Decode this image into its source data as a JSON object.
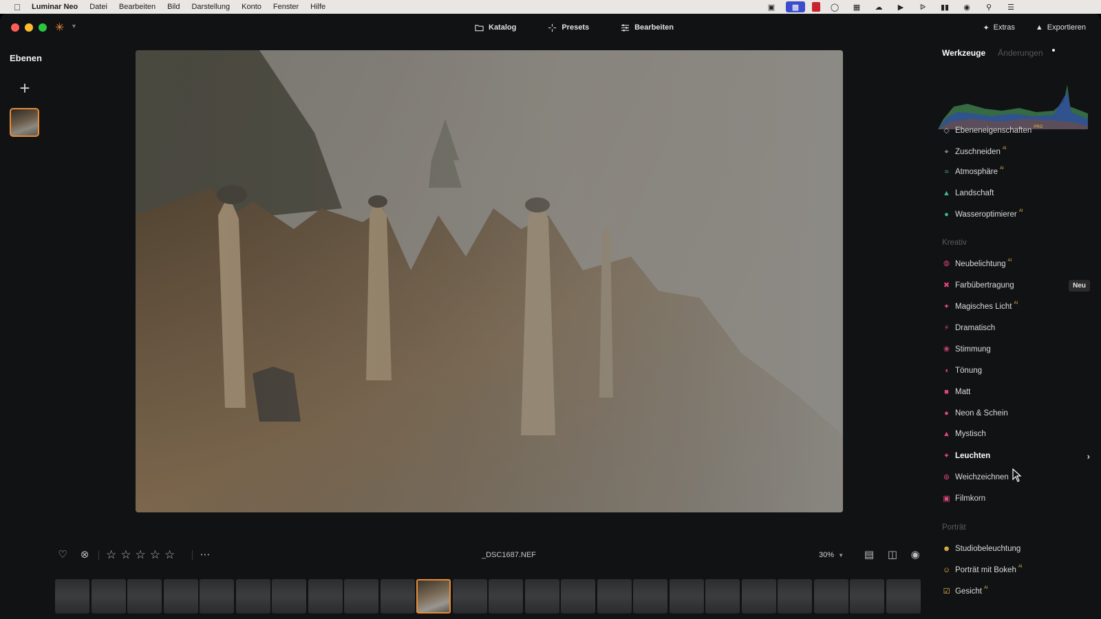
{
  "menubar": {
    "app_name": "Luminar Neo",
    "items": [
      "Datei",
      "Bearbeiten",
      "Bild",
      "Darstellung",
      "Konto",
      "Fenster",
      "Hilfe"
    ],
    "status_icons": [
      "bookmark-icon",
      "display-icon",
      "red-app-icon",
      "timer-icon",
      "grid-icon",
      "cloud-icon",
      "play-icon",
      "bluetooth-icon",
      "battery-icon",
      "wifi-icon",
      "search-icon",
      "control-center-icon"
    ]
  },
  "toolbar": {
    "tabs": [
      {
        "label": "Katalog",
        "icon": "folder-icon"
      },
      {
        "label": "Presets",
        "icon": "sparkle-icon"
      },
      {
        "label": "Bearbeiten",
        "icon": "sliders-icon"
      }
    ],
    "extras_label": "Extras",
    "export_label": "Exportieren"
  },
  "layers": {
    "title": "Ebenen"
  },
  "bottom": {
    "filename": "_DSC1687.NEF",
    "zoom": "30%"
  },
  "tools": {
    "tab_active": "Werkzeuge",
    "tab_inactive": "Änderungen",
    "essentials": [
      {
        "label": "Ebeneneigenschaften",
        "sup": "PRO",
        "icon": "layers-icon",
        "color": "#bdbdbd"
      },
      {
        "label": "Zuschneiden",
        "sup": "AI",
        "icon": "crop-icon",
        "color": "#bdbdbd"
      },
      {
        "label": "Atmosphäre",
        "sup": "AI",
        "icon": "atmosphere-icon",
        "color": "#3fb98f"
      },
      {
        "label": "Landschaft",
        "sup": "",
        "icon": "landscape-icon",
        "color": "#3fb98f"
      },
      {
        "label": "Wasseroptimierer",
        "sup": "AI",
        "icon": "water-drop-icon",
        "color": "#3fb98f"
      }
    ],
    "section_creative": "Kreativ",
    "creative": [
      {
        "label": "Neubelichtung",
        "sup": "AI",
        "icon": "relight-icon",
        "color": "#e0457b"
      },
      {
        "label": "Farbübertragung",
        "sup": "",
        "icon": "color-transfer-icon",
        "color": "#e0457b",
        "badge": "Neu"
      },
      {
        "label": "Magisches Licht",
        "sup": "AI",
        "icon": "magic-light-icon",
        "color": "#e0457b"
      },
      {
        "label": "Dramatisch",
        "sup": "",
        "icon": "bolt-icon",
        "color": "#e0457b"
      },
      {
        "label": "Stimmung",
        "sup": "",
        "icon": "mood-icon",
        "color": "#e0457b"
      },
      {
        "label": "Tönung",
        "sup": "",
        "icon": "toning-icon",
        "color": "#e0457b"
      },
      {
        "label": "Matt",
        "sup": "",
        "icon": "matte-icon",
        "color": "#e0457b"
      },
      {
        "label": "Neon & Schein",
        "sup": "",
        "icon": "neon-icon",
        "color": "#e0457b"
      },
      {
        "label": "Mystisch",
        "sup": "",
        "icon": "mystic-icon",
        "color": "#e0457b"
      },
      {
        "label": "Leuchten",
        "sup": "",
        "icon": "glow-icon",
        "color": "#e0457b",
        "highlight": true
      },
      {
        "label": "Weichzeichnen",
        "sup": "",
        "icon": "blur-icon",
        "color": "#e0457b"
      },
      {
        "label": "Filmkorn",
        "sup": "",
        "icon": "film-grain-icon",
        "color": "#e0457b"
      }
    ],
    "section_portrait": "Porträt",
    "portrait": [
      {
        "label": "Studiobeleuchtung",
        "sup": "",
        "icon": "studio-light-icon",
        "color": "#e8b84a"
      },
      {
        "label": "Porträt mit Bokeh",
        "sup": "AI",
        "icon": "bokeh-icon",
        "color": "#e8b84a"
      },
      {
        "label": "Gesicht",
        "sup": "AI",
        "icon": "face-icon",
        "color": "#e8b84a"
      }
    ]
  },
  "colors": {
    "accent": "#e98c35",
    "creative": "#e0457b",
    "essentials": "#3fb98f",
    "portrait": "#e8b84a"
  }
}
